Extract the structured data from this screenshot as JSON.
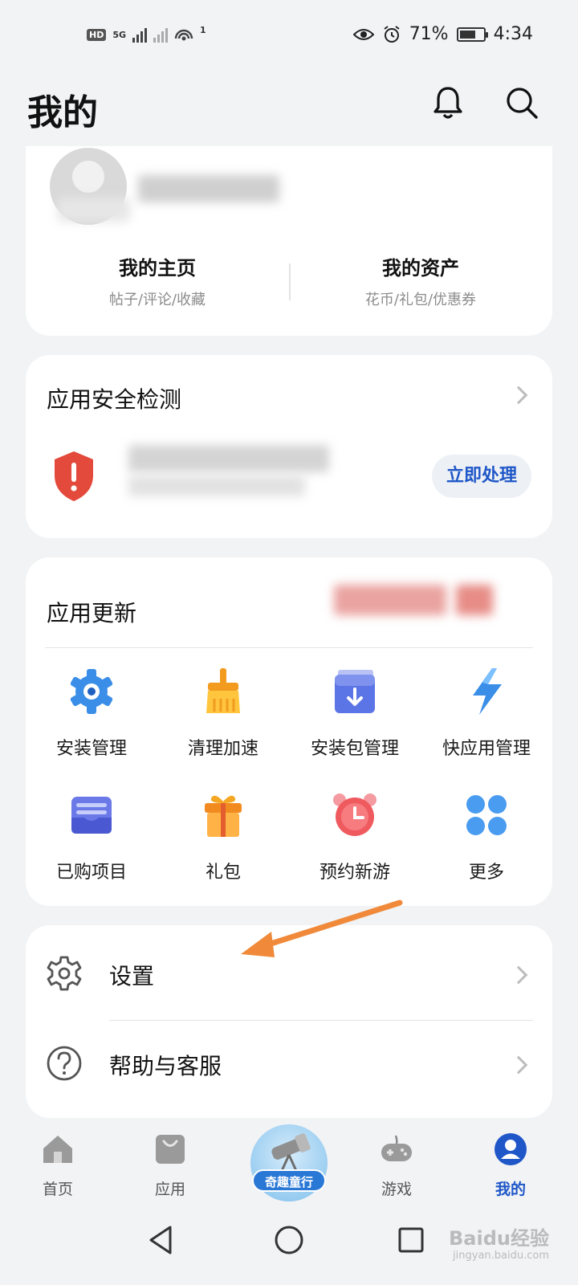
{
  "status_bar": {
    "hd_label": "HD",
    "network_label": "5G",
    "hotspot_count": "1",
    "battery_percent": "71%",
    "battery_level": 0.71,
    "time": "4:34"
  },
  "header": {
    "title": "我的",
    "icons": [
      "bell-icon",
      "search-icon"
    ]
  },
  "profile": {
    "home": {
      "title": "我的主页",
      "subtitle": "帖子/评论/收藏"
    },
    "assets": {
      "title": "我的资产",
      "subtitle": "花币/礼包/优惠券"
    }
  },
  "security": {
    "title": "应用安全检测",
    "action_label": "立即处理",
    "shield_color": "#e34a3c"
  },
  "updates": {
    "title": "应用更新",
    "grid": [
      {
        "label": "安装管理",
        "icon": "gear-icon"
      },
      {
        "label": "清理加速",
        "icon": "brush-icon"
      },
      {
        "label": "安装包管理",
        "icon": "package-icon"
      },
      {
        "label": "快应用管理",
        "icon": "lightning-icon"
      },
      {
        "label": "已购项目",
        "icon": "purchased-icon"
      },
      {
        "label": "礼包",
        "icon": "gift-icon"
      },
      {
        "label": "预约新游",
        "icon": "alarm-clock-icon"
      },
      {
        "label": "更多",
        "icon": "more-grid-icon"
      }
    ]
  },
  "settings_list": {
    "settings_label": "设置",
    "help_label": "帮助与客服"
  },
  "bottom_nav": {
    "home": "首页",
    "apps": "应用",
    "promo": "奇趣童行",
    "games": "游戏",
    "me": "我的"
  },
  "watermark": {
    "brand": "Baidu经验",
    "url": "jingyan.baidu.com"
  },
  "colors": {
    "accent": "#1f57c8",
    "annotation_arrow": "#f08a3a",
    "page_bg": "#f1f3f5"
  }
}
